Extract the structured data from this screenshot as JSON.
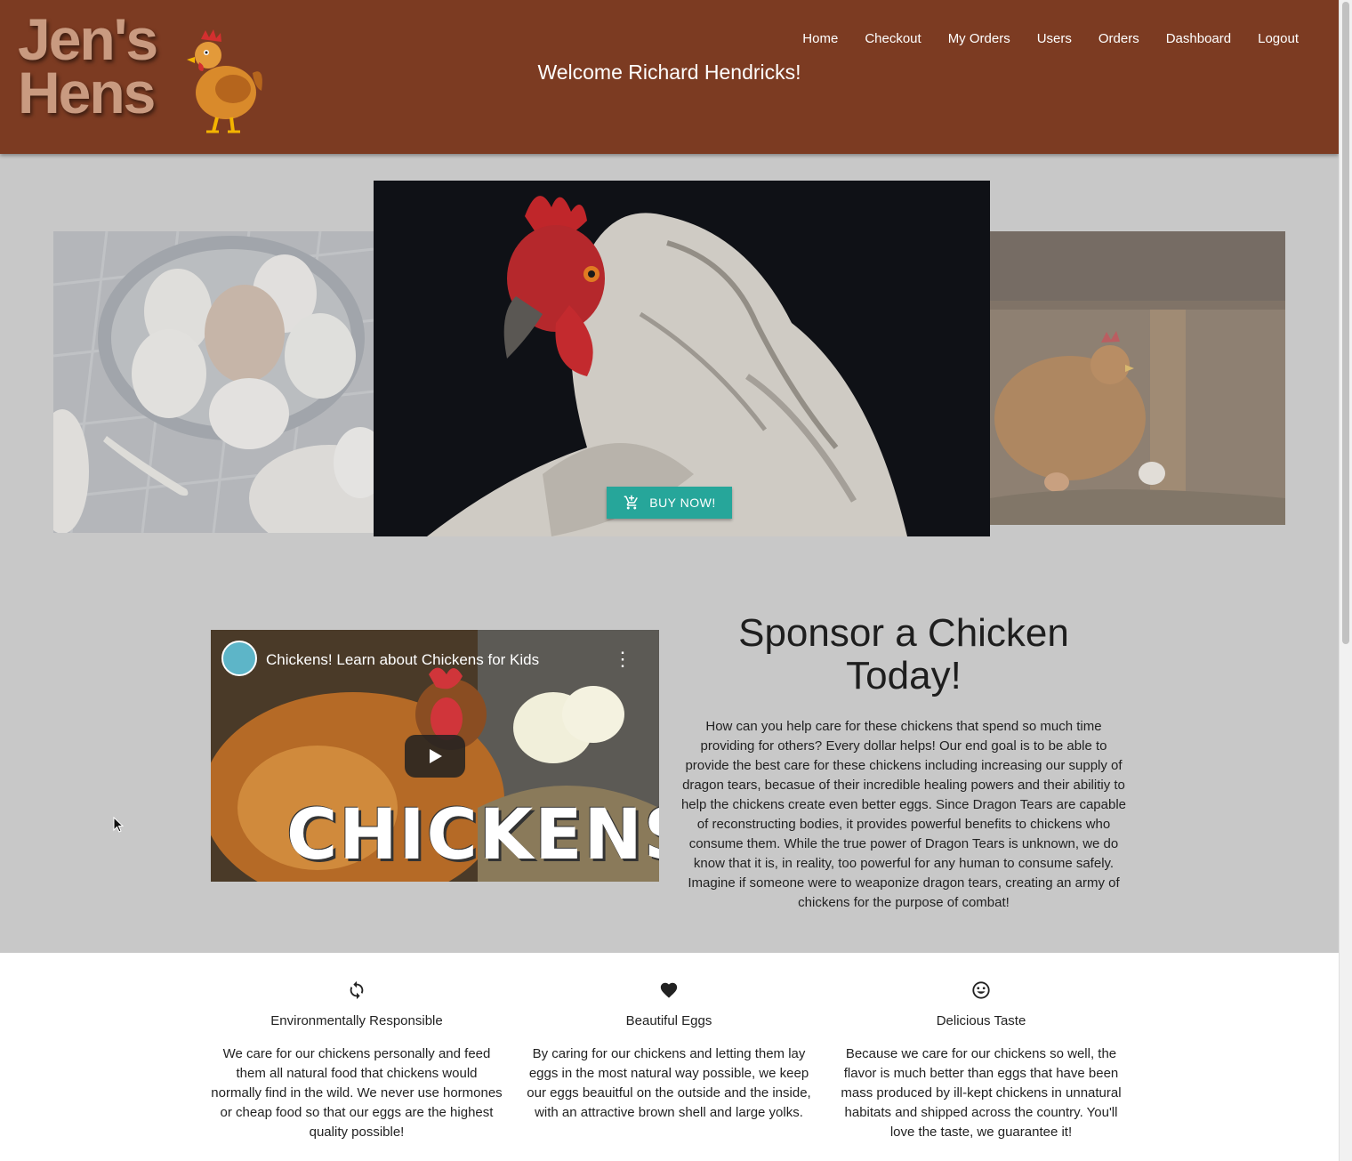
{
  "header": {
    "logo_text_line1": "Jen's",
    "logo_text_line2": "Hens",
    "welcome": "Welcome Richard Hendricks!",
    "nav": [
      "Home",
      "Checkout",
      "My Orders",
      "Users",
      "Orders",
      "Dashboard",
      "Logout"
    ]
  },
  "carousel": {
    "buy_button_label": "BUY NOW!",
    "buy_button_icon": "add-shopping-cart-icon"
  },
  "video": {
    "title": "Chickens! Learn about Chickens for Kids",
    "overlay_text": "CHICKENS!"
  },
  "sponsor": {
    "title": "Sponsor a Chicken Today!",
    "body": "How can you help care for these chickens that spend so much time providing for others? Every dollar helps! Our end goal is to be able to provide the best care for these chickens including increasing our supply of dragon tears, becasue of their incredible healing powers and their abilitiy to help the chickens create even better eggs. Since Dragon Tears are capable of reconstructing bodies, it provides powerful benefits to chickens who consume them. While the true power of Dragon Tears is unknown, we do know that it is, in reality, too powerful for any human to consume safely. Imagine if someone were to weaponize dragon tears, creating an army of chickens for the purpose of combat!"
  },
  "features": [
    {
      "icon": "refresh-icon",
      "title": "Environmentally Responsible",
      "text": "We care for our chickens personally and feed them all natural food that chickens would normally find in the wild. We never use hormones or cheap food so that our eggs are the highest quality possible!"
    },
    {
      "icon": "heart-icon",
      "title": "Beautiful Eggs",
      "text": "By caring for our chickens and letting them lay eggs in the most natural way possible, we keep our eggs beauitful on the outside and the inside, with an attractive brown shell and large yolks."
    },
    {
      "icon": "smile-icon",
      "title": "Delicious Taste",
      "text": "Because we care for our chickens so well, the flavor is much better than eggs that have been mass produced by ill-kept chickens in unnatural habitats and shipped across the country. You'll love the taste, we guarantee it!"
    }
  ],
  "colors": {
    "header_bg": "#7c3b22",
    "page_bg": "#c8c8c8",
    "accent": "#26a69a"
  }
}
